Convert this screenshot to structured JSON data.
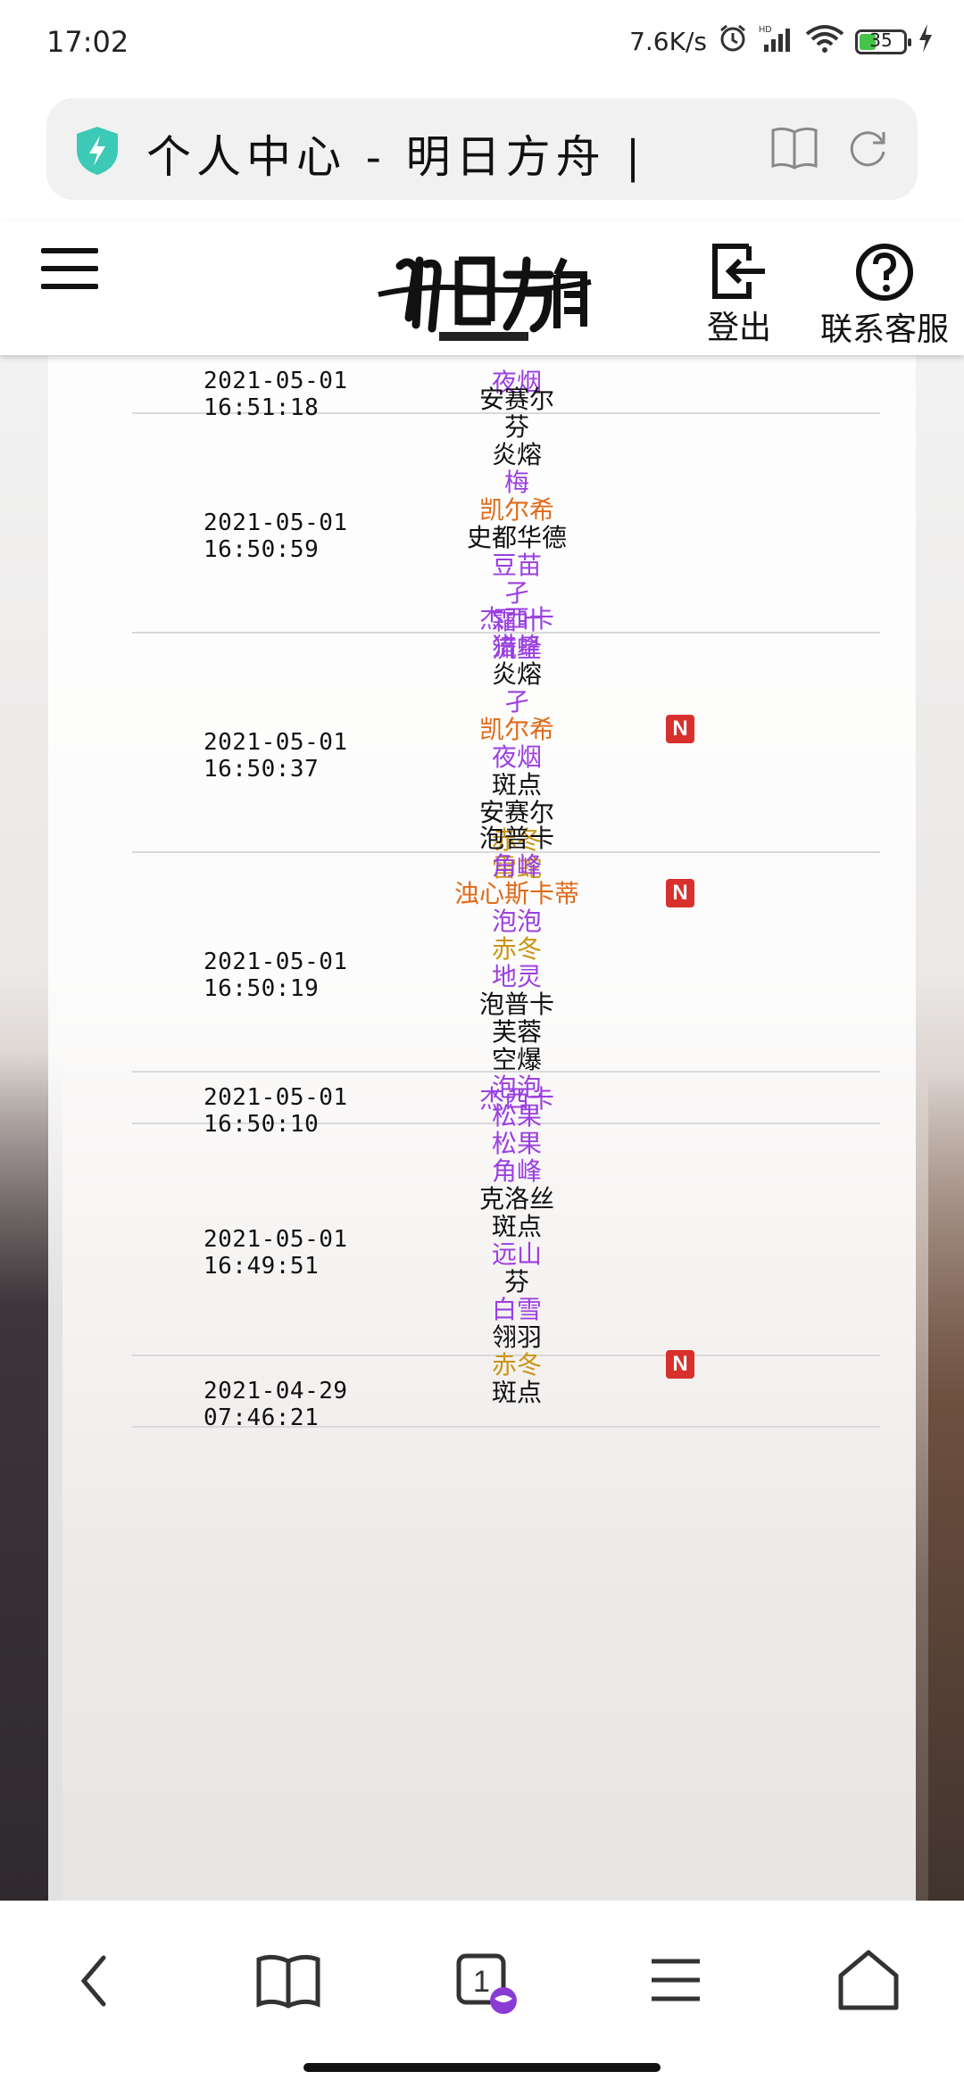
{
  "status_bar": {
    "time": "17:02",
    "net_speed": "7.6K/s",
    "battery": "35",
    "icons": [
      "alarm-icon",
      "signal-icon",
      "wifi-icon",
      "battery-icon",
      "charging-icon"
    ]
  },
  "address_bar": {
    "title": "个人中心 - 明日方舟 | ",
    "icons": [
      "shield-icon",
      "reader-icon",
      "reload-icon"
    ]
  },
  "header": {
    "logout_label": "登出",
    "help_label": "联系客服",
    "icons": [
      "menu-icon",
      "logo",
      "logout-icon",
      "help-icon"
    ]
  },
  "colors": {
    "purple": "#9b3fe0",
    "orange": "#e06b1a",
    "gold": "#c99512",
    "black": "#111111",
    "badge": "#d8302d"
  },
  "records": [
    {
      "time": "2021-05-01 16:51:18",
      "items": [
        {
          "name": "夜烟",
          "color": "purple"
        }
      ]
    },
    {
      "time": "2021-05-01 16:50:59",
      "items": [
        {
          "name": "安赛尔",
          "color": "black"
        },
        {
          "name": "芬",
          "color": "black"
        },
        {
          "name": "炎熔",
          "color": "black"
        },
        {
          "name": "梅",
          "color": "purple"
        },
        {
          "name": "凯尔希",
          "color": "orange"
        },
        {
          "name": "史都华德",
          "color": "black"
        },
        {
          "name": "豆苗",
          "color": "purple"
        },
        {
          "name": "孑",
          "color": "purple"
        },
        {
          "name": "霜叶",
          "color": "purple"
        },
        {
          "name": "流星",
          "color": "purple"
        }
      ]
    },
    {
      "time": "2021-05-01 16:50:37",
      "items": [
        {
          "name": "杰西卡",
          "color": "purple"
        },
        {
          "name": "猎蜂",
          "color": "purple"
        },
        {
          "name": "炎熔",
          "color": "black"
        },
        {
          "name": "孑",
          "color": "purple"
        },
        {
          "name": "凯尔希",
          "color": "orange",
          "badge": "N"
        },
        {
          "name": "夜烟",
          "color": "purple"
        },
        {
          "name": "斑点",
          "color": "black"
        },
        {
          "name": "安赛尔",
          "color": "black"
        },
        {
          "name": "赤冬",
          "color": "gold"
        },
        {
          "name": "雷蛇",
          "color": "gold"
        }
      ]
    },
    {
      "time": "2021-05-01 16:50:19",
      "items": [
        {
          "name": "泡普卡",
          "color": "black"
        },
        {
          "name": "角峰",
          "color": "purple"
        },
        {
          "name": "浊心斯卡蒂",
          "color": "orange",
          "badge": "N"
        },
        {
          "name": "泡泡",
          "color": "purple"
        },
        {
          "name": "赤冬",
          "color": "gold"
        },
        {
          "name": "地灵",
          "color": "purple"
        },
        {
          "name": "泡普卡",
          "color": "black"
        },
        {
          "name": "芙蓉",
          "color": "black"
        },
        {
          "name": "空爆",
          "color": "black"
        },
        {
          "name": "泡泡",
          "color": "purple"
        }
      ]
    },
    {
      "time": "2021-05-01 16:50:10",
      "items": [
        {
          "name": "杰西卡",
          "color": "purple"
        }
      ]
    },
    {
      "time": "2021-05-01 16:49:51",
      "items": [
        {
          "name": "松果",
          "color": "purple"
        },
        {
          "name": "松果",
          "color": "purple"
        },
        {
          "name": "角峰",
          "color": "purple"
        },
        {
          "name": "克洛丝",
          "color": "black"
        },
        {
          "name": "斑点",
          "color": "black"
        },
        {
          "name": "远山",
          "color": "purple"
        },
        {
          "name": "芬",
          "color": "black"
        },
        {
          "name": "白雪",
          "color": "purple"
        },
        {
          "name": "翎羽",
          "color": "black"
        },
        {
          "name": "赤冬",
          "color": "gold",
          "badge": "N"
        }
      ]
    },
    {
      "time": "2021-04-29 07:46:21",
      "items": [
        {
          "name": "斑点",
          "color": "black"
        }
      ]
    }
  ],
  "bottom_nav": {
    "tab_count": "1",
    "icons": [
      "back-icon",
      "bookmarks-icon",
      "tabs-icon",
      "menu-icon",
      "home-icon"
    ]
  }
}
